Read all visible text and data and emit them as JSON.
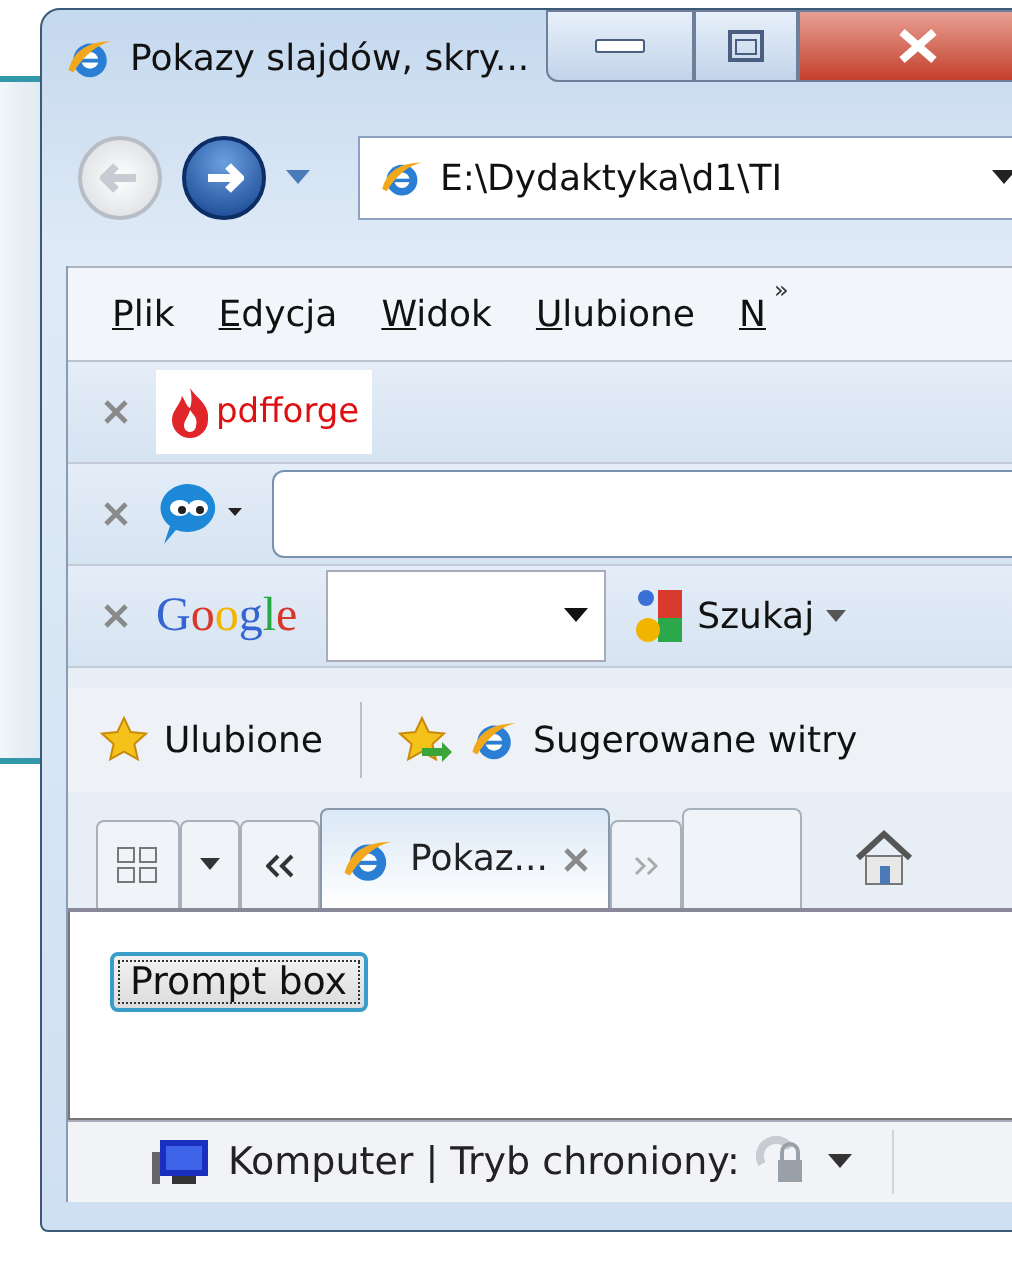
{
  "window": {
    "title": "Pokazy slajdów, skry..."
  },
  "address_bar": {
    "value": "E:\\Dydaktyka\\d1\\TI"
  },
  "menu_bar": {
    "items": [
      "Plik",
      "Edycja",
      "Widok",
      "Ulubione",
      "N"
    ],
    "overflow": "»"
  },
  "toolbars": [
    {
      "kind": "logo",
      "logo": "pdfforge"
    },
    {
      "kind": "field"
    },
    {
      "kind": "google",
      "logo": "Google",
      "button": "Szukaj"
    }
  ],
  "favorites_bar": {
    "favorites": "Ulubione",
    "suggested": "Sugerowane witry"
  },
  "tabs": [
    {
      "label": "Pokaz...",
      "selected": true
    },
    {
      "selected": false
    }
  ],
  "content": {
    "button": "Prompt box"
  },
  "status_bar": {
    "zone": "Komputer | Tryb chroniony:"
  }
}
